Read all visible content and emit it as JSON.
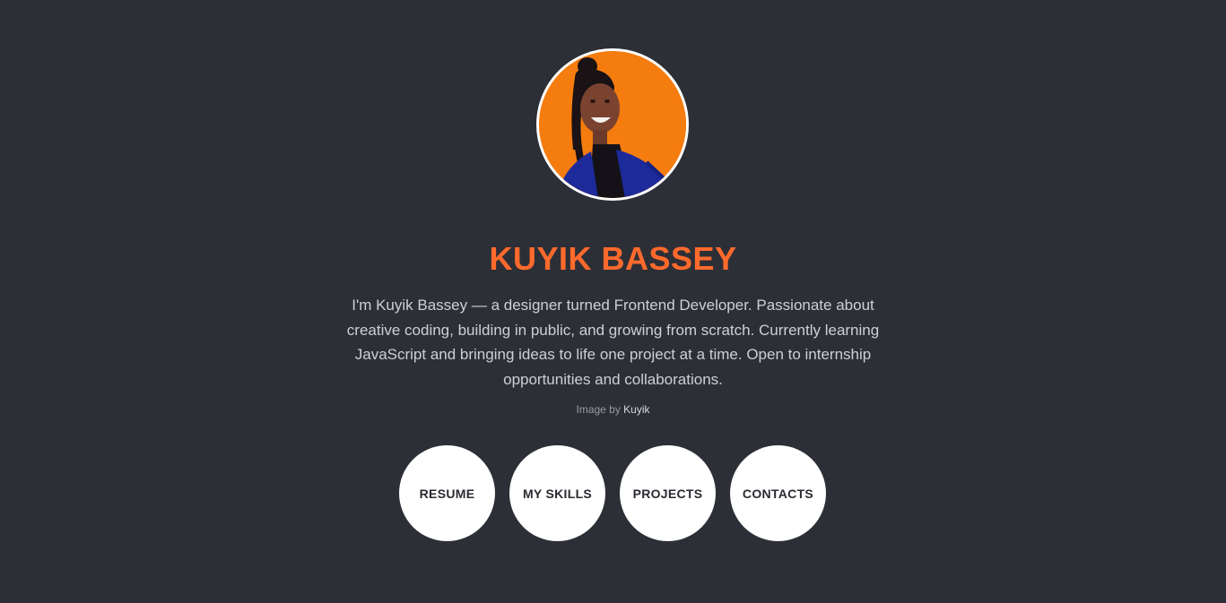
{
  "profile": {
    "name": "KUYIK BASSEY",
    "bio": "I'm Kuyik Bassey — a designer turned Frontend Developer. Passionate about creative coding, building in public, and growing from scratch. Currently learning JavaScript and bringing ideas to life one project at a time. Open to internship opportunities and collaborations.",
    "photo_background_color": "#f57c0f"
  },
  "credit": {
    "prefix": "Image by",
    "author": "Kuyik"
  },
  "nav": {
    "items": [
      {
        "label": "RESUME"
      },
      {
        "label": "MY SKILLS"
      },
      {
        "label": "PROJECTS"
      },
      {
        "label": "CONTACTS"
      }
    ]
  },
  "colors": {
    "background": "#2d2f37",
    "accent": "#ff6a2c",
    "button_bg": "#ffffff"
  }
}
